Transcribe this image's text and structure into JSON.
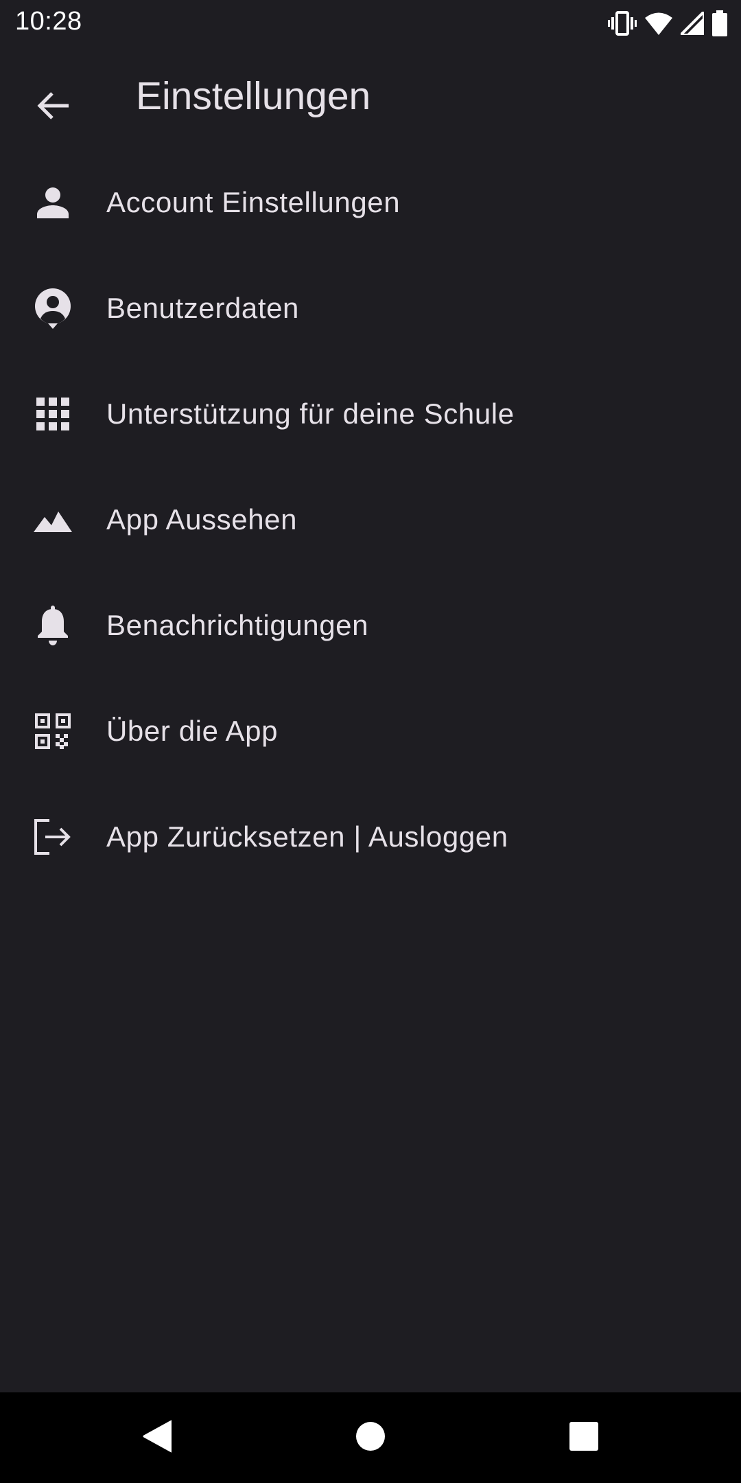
{
  "status_bar": {
    "time": "10:28",
    "icons": [
      "vibrate-icon",
      "wifi-icon",
      "signal-icon",
      "battery-icon"
    ]
  },
  "app_bar": {
    "title": "Einstellungen",
    "back_icon": "arrow-back-icon"
  },
  "settings": {
    "items": [
      {
        "icon": "person-icon",
        "label": "Account Einstellungen"
      },
      {
        "icon": "account-circle-icon",
        "label": "Benutzerdaten"
      },
      {
        "icon": "apps-grid-icon",
        "label": "Unterstützung für deine Schule"
      },
      {
        "icon": "landscape-icon",
        "label": "App Aussehen"
      },
      {
        "icon": "bell-icon",
        "label": "Benachrichtigungen"
      },
      {
        "icon": "qr-code-icon",
        "label": "Über die App"
      },
      {
        "icon": "logout-icon",
        "label": "App Zurücksetzen | Ausloggen"
      }
    ]
  },
  "nav_bar": {
    "buttons": [
      "back-triangle-icon",
      "home-circle-icon",
      "recents-square-icon"
    ]
  },
  "colors": {
    "background": "#1e1d22",
    "text": "#e6e1e8",
    "nav_background": "#000000"
  }
}
